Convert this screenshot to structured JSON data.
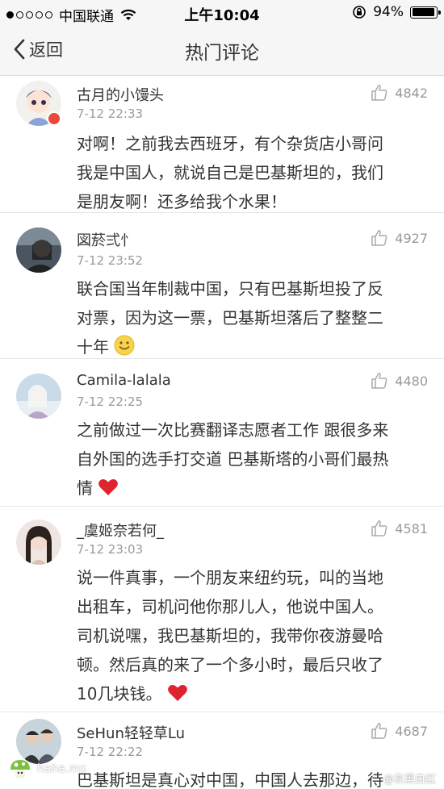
{
  "status_bar": {
    "carrier": "中国联通",
    "time": "上午10:04",
    "battery": "94%",
    "battery_level": 0.94
  },
  "nav": {
    "back_label": "返回",
    "title": "热门评论"
  },
  "comments": [
    {
      "user": "古月的小馒头",
      "time": "7-12 22:33",
      "likes": "4842",
      "lines": [
        "对啊！之前我去西班牙，有个杂货店小哥问",
        "我是中国人，就说自己是巴基斯坦的，我们",
        "是朋友啊！还多给我个水果！"
      ]
    },
    {
      "user": "図菸弍忄",
      "time": "7-12 23:52",
      "likes": "4927",
      "lines": [
        "联合国当年制裁中国，只有巴基斯坦投了反",
        "对票，因为这一票，巴基斯坦落后了整整二",
        "十年"
      ]
    },
    {
      "user": "Camila-lalala",
      "time": "7-12 22:25",
      "likes": "4480",
      "lines": [
        "之前做过一次比赛翻译志愿者工作 跟很多来",
        "自外国的选手打交道 巴基斯塔的小哥们最热",
        "情"
      ]
    },
    {
      "user": "_虞姬奈若何_",
      "time": "7-12 23:03",
      "likes": "4581",
      "lines": [
        "说一件真事，一个朋友来纽约玩，叫的当地",
        "出租车，司机问他你那儿人，他说中国人。",
        "司机说嘿，我巴基斯坦的，我带你夜游曼哈",
        "顿。然后真的来了一个多小时，最后只收了",
        "10几块钱。"
      ]
    },
    {
      "user": "SeHun轻轻草Lu",
      "time": "7-12 22:22",
      "likes": "4687",
      "lines": [
        "巴基斯坦是真心对中国，中国人去那边，待"
      ]
    }
  ],
  "watermarks": {
    "left": "haha.mx",
    "right": "@灰黑白红"
  },
  "colors": {
    "bar_bg": "#f6f6f6",
    "heart": "#e0242f",
    "badge": "#e8493b"
  }
}
